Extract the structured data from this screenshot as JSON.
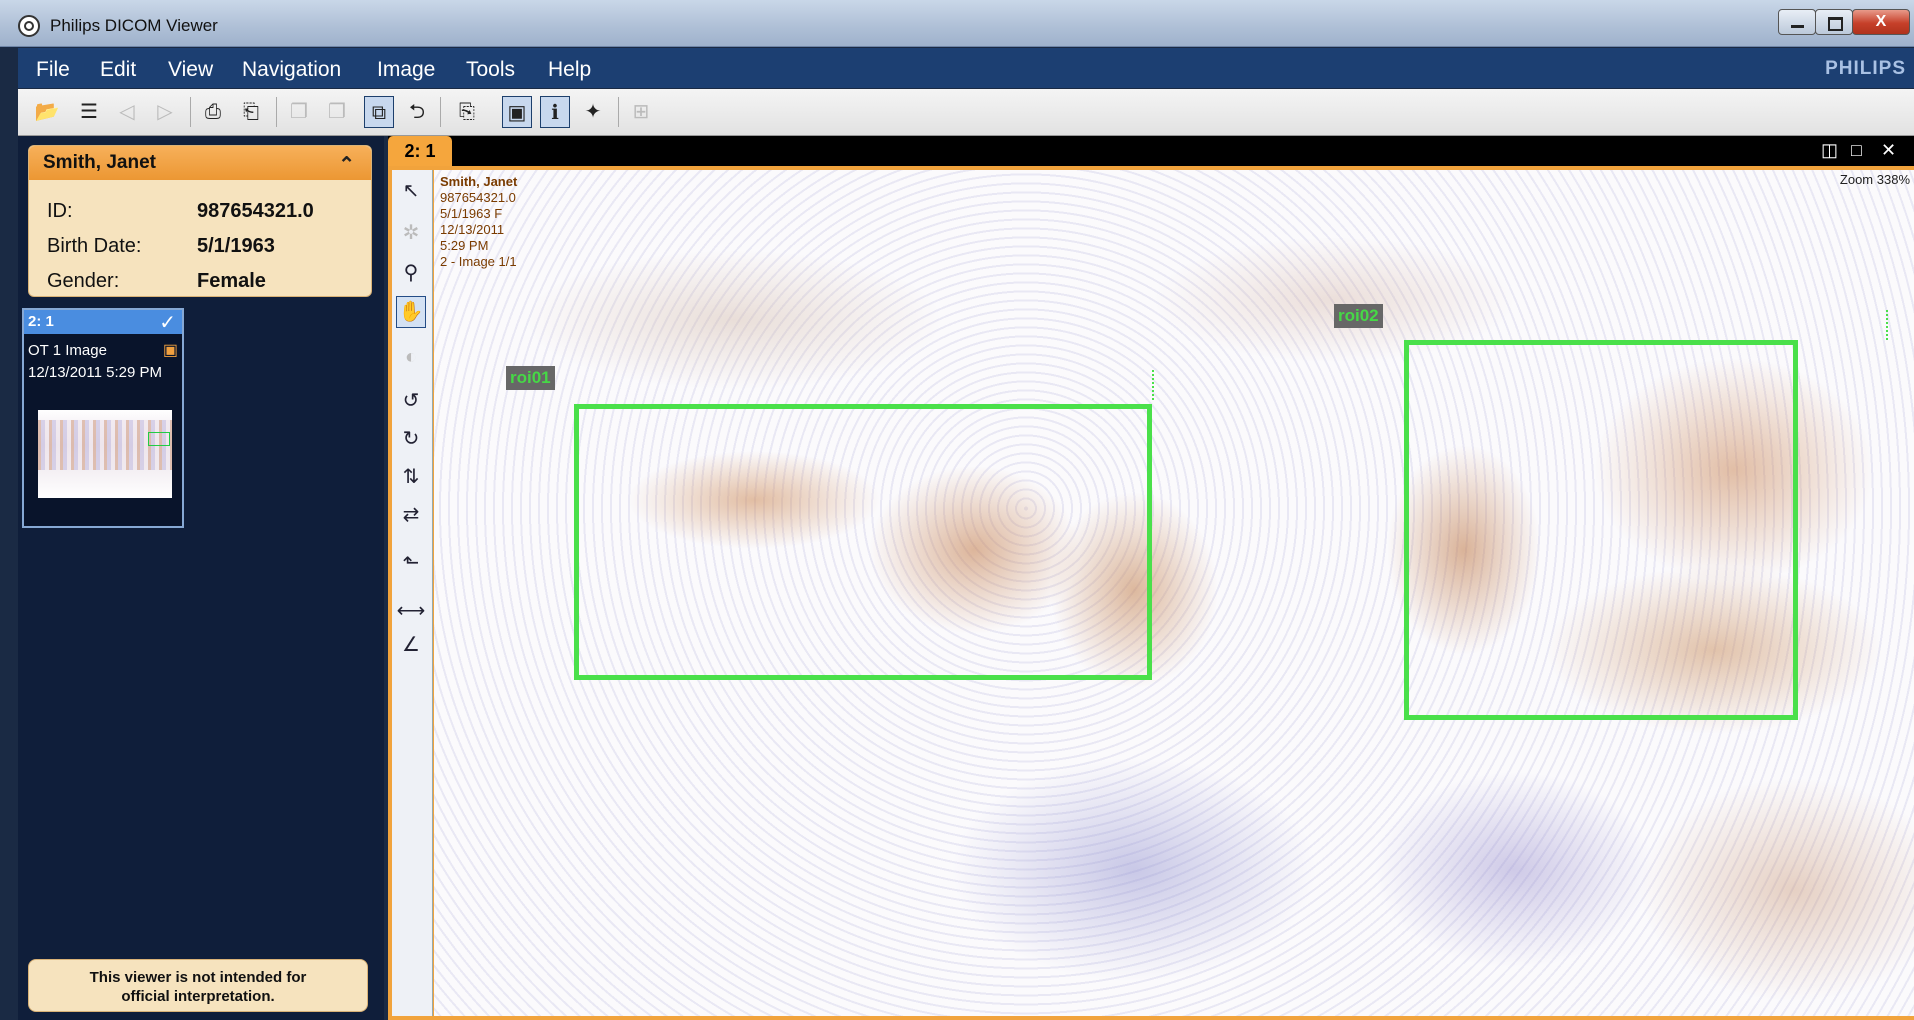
{
  "window": {
    "title": "Philips DICOM Viewer",
    "close_label": "X"
  },
  "menu": {
    "items": [
      "File",
      "Edit",
      "View",
      "Navigation",
      "Image",
      "Tools",
      "Help"
    ],
    "brand": "PHILIPS"
  },
  "patient": {
    "name": "Smith, Janet",
    "fields": [
      {
        "label": "ID:",
        "value": "987654321.0"
      },
      {
        "label": "Birth Date:",
        "value": "5/1/1963"
      },
      {
        "label": "Gender:",
        "value": "Female"
      }
    ]
  },
  "series": {
    "label": "2: 1",
    "description": "OT 1 Image",
    "datetime": "12/13/2011 5:29 PM"
  },
  "disclaimer": {
    "line1": "This viewer is not intended for",
    "line2": "official interpretation."
  },
  "viewer": {
    "tab_label": "2: 1",
    "zoom": "Zoom 338%",
    "overlay": [
      "Smith, Janet",
      "987654321.0",
      "5/1/1963  F",
      "12/13/2011",
      "5:29 PM",
      "2 -  Image 1/1"
    ],
    "rois": [
      {
        "label": "roi01"
      },
      {
        "label": "roi02"
      }
    ]
  },
  "colors": {
    "menubar": "#1c3f72",
    "patient_header": "#f0a040",
    "roi": "#4ae04a",
    "panel": "#0f1e3a"
  }
}
